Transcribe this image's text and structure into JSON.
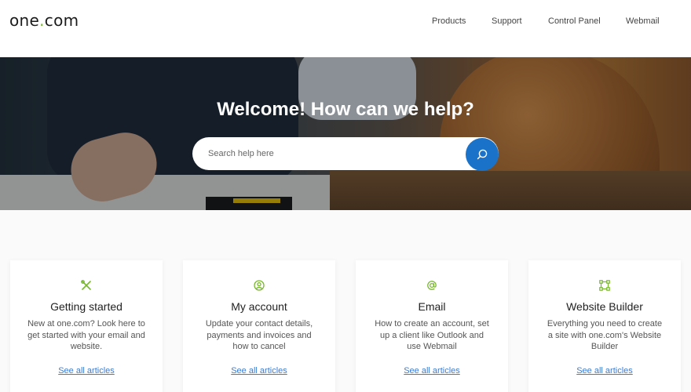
{
  "header": {
    "logo_text_1": "one",
    "logo_dot": ".",
    "logo_text_2": "com",
    "nav": [
      {
        "label": "Products"
      },
      {
        "label": "Support"
      },
      {
        "label": "Control Panel"
      },
      {
        "label": "Webmail"
      }
    ]
  },
  "hero": {
    "title": "Welcome! How can we help?",
    "search_placeholder": "Search help here"
  },
  "cards": [
    {
      "icon": "tools-icon",
      "title": "Getting started",
      "description": "New at one.com? Look here to get started with your email and website.",
      "link": "See all articles"
    },
    {
      "icon": "user-circle-icon",
      "title": "My account",
      "description": "Update your contact details, payments and invoices and how to cancel",
      "link": "See all articles"
    },
    {
      "icon": "at-sign-icon",
      "title": "Email",
      "description": "How to create an account, set up a client like Outlook and use Webmail",
      "link": "See all articles"
    },
    {
      "icon": "website-builder-icon",
      "title": "Website Builder",
      "description": "Everything you need to create a site with one.com's Website Builder",
      "link": "See all articles"
    }
  ],
  "colors": {
    "brand_green": "#76b82a",
    "search_button_blue": "#1a73c9",
    "link_blue": "#3d7bd0"
  }
}
